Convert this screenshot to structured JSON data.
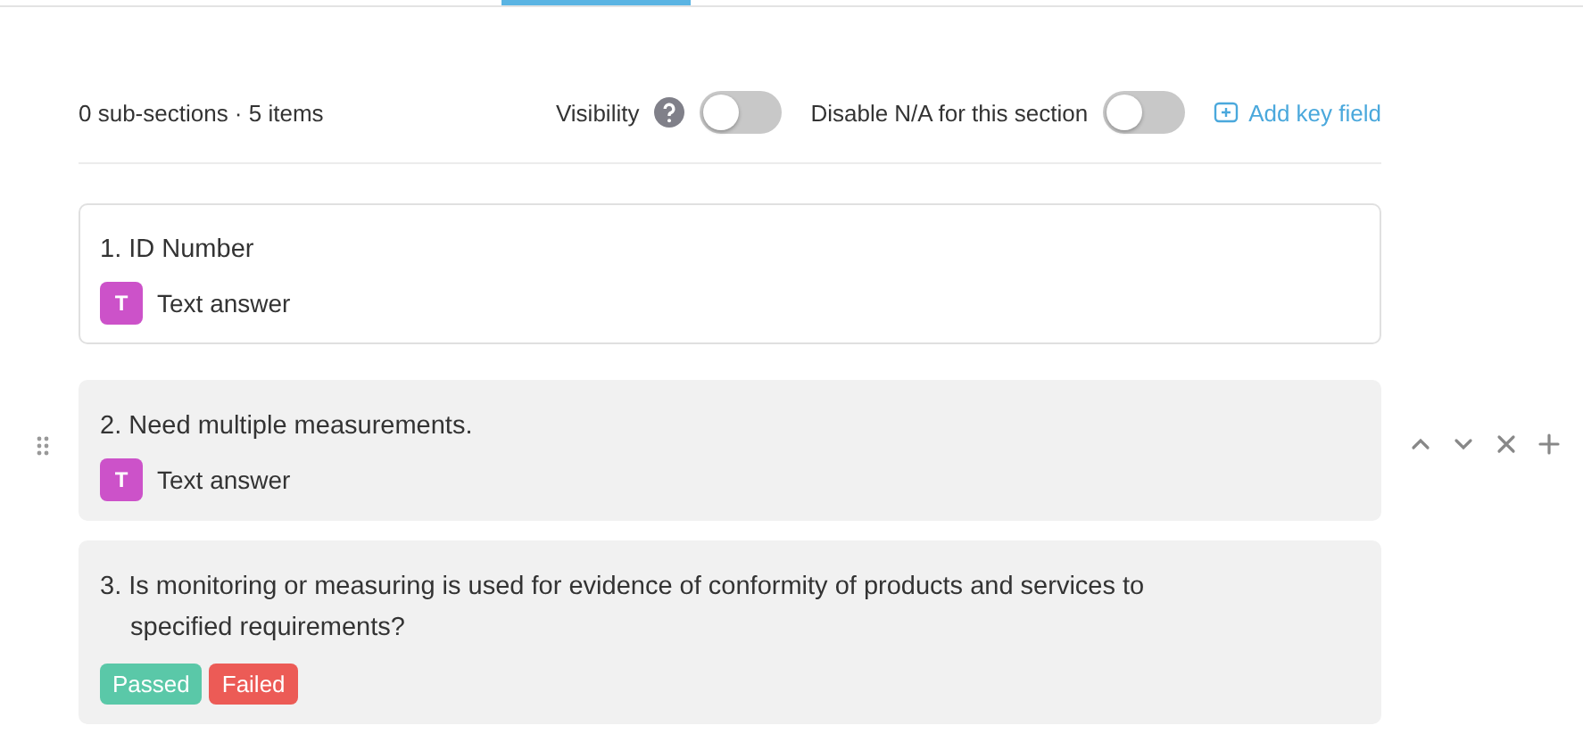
{
  "summary": "0 sub-sections · 5 items",
  "toggles": [
    {
      "label": "Visibility",
      "help": true,
      "on": false
    },
    {
      "label": "Disable N/A for this section",
      "help": false,
      "on": false
    }
  ],
  "add_key_field": "Add key field",
  "items": [
    {
      "title": "1. ID Number",
      "kind": "text",
      "answer": "Text answer",
      "badge": "T",
      "shaded": false,
      "selected": false
    },
    {
      "title": "2. Need multiple measurements.",
      "kind": "text",
      "answer": "Text answer",
      "badge": "T",
      "shaded": true,
      "selected": true
    },
    {
      "title": "3. Is monitoring or measuring is used for evidence of conformity of products and services to specified requirements?",
      "kind": "choice",
      "responses": [
        {
          "label": "Passed",
          "color": "#5ac8a8"
        },
        {
          "label": "Failed",
          "color": "#ec5b56"
        }
      ],
      "shaded": true,
      "selected": false
    }
  ]
}
